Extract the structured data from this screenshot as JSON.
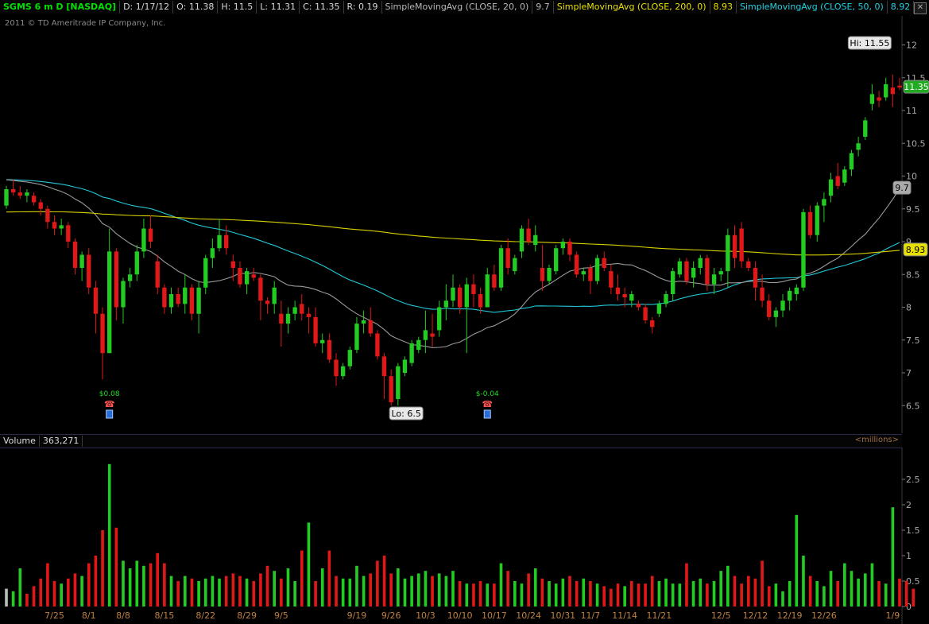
{
  "header": {
    "symbol": "SGMS 6 m D [NASDAQ]",
    "date": "D: 1/17/12",
    "open": "O: 11.38",
    "high": "H: 11.5",
    "low": "L: 11.31",
    "close": "C: 11.35",
    "range": "R: 0.19",
    "sma20_label": "SimpleMovingAvg (CLOSE, 20, 0)",
    "sma20_value": "9.7",
    "sma200_label": "SimpleMovingAvg (CLOSE, 200, 0)",
    "sma200_value": "8.93",
    "sma50_label": "SimpleMovingAvg (CLOSE, 50, 0)",
    "sma50_value": "8.92",
    "close_icon": "window-close-icon"
  },
  "copyright": "2011 © TD Ameritrade IP Company, Inc.",
  "volume_header": {
    "label": "Volume",
    "value": "363,271",
    "unit": "<millions>"
  },
  "colors": {
    "up": "#22cc22",
    "down": "#e01818",
    "sma20": "#9a9a9a",
    "sma50": "#22c8d8",
    "sma200": "#d8d000",
    "background": "#000000"
  },
  "chart_data": [
    {
      "type": "candlestick",
      "title": "SGMS 6 m D [NASDAQ]",
      "ylim": [
        6.2,
        12.2
      ],
      "yticks": [
        6.5,
        7,
        7.5,
        8,
        8.5,
        9,
        9.5,
        10,
        10.5,
        11,
        11.5,
        12
      ],
      "xlabels": [
        "7/25",
        "8/1",
        "8/8",
        "8/15",
        "8/22",
        "8/29",
        "9/5",
        "9/19",
        "9/26",
        "10/3",
        "10/10",
        "10/17",
        "10/24",
        "10/31",
        "11/7",
        "11/14",
        "11/21",
        "12/5",
        "12/12",
        "12/19",
        "12/26",
        "1/9"
      ],
      "annotations": {
        "high": "Hi: 11.55",
        "low": "Lo: 6.5",
        "last_price": "11.35",
        "sma20_tag": "9.7",
        "sma200_tag": "8.93",
        "dividend1": "$0.08",
        "dividend2": "$-0.04"
      },
      "candles": [
        [
          9.55,
          9.85,
          9.5,
          9.8
        ],
        [
          9.8,
          9.95,
          9.7,
          9.75
        ],
        [
          9.75,
          9.85,
          9.65,
          9.7
        ],
        [
          9.7,
          9.8,
          9.6,
          9.75
        ],
        [
          9.7,
          9.75,
          9.55,
          9.6
        ],
        [
          9.6,
          9.65,
          9.4,
          9.5
        ],
        [
          9.5,
          9.55,
          9.2,
          9.3
        ],
        [
          9.3,
          9.4,
          9.1,
          9.2
        ],
        [
          9.2,
          9.35,
          9.1,
          9.25
        ],
        [
          9.25,
          9.3,
          8.9,
          9.0
        ],
        [
          9.0,
          9.05,
          8.5,
          8.6
        ],
        [
          8.6,
          8.85,
          8.4,
          8.8
        ],
        [
          8.8,
          8.9,
          8.2,
          8.3
        ],
        [
          8.3,
          8.4,
          7.6,
          7.9
        ],
        [
          7.9,
          8.0,
          6.9,
          7.3
        ],
        [
          7.3,
          9.2,
          7.3,
          8.85
        ],
        [
          8.85,
          8.9,
          7.8,
          8.0
        ],
        [
          8.0,
          8.45,
          7.75,
          8.4
        ],
        [
          8.4,
          8.6,
          8.3,
          8.5
        ],
        [
          8.5,
          8.95,
          8.4,
          8.85
        ],
        [
          8.85,
          9.35,
          8.75,
          9.2
        ],
        [
          9.2,
          9.4,
          8.9,
          9.0
        ],
        [
          8.7,
          8.8,
          8.2,
          8.3
        ],
        [
          8.3,
          8.35,
          7.9,
          8.0
        ],
        [
          8.0,
          8.3,
          7.9,
          8.2
        ],
        [
          8.2,
          8.3,
          8.0,
          8.05
        ],
        [
          8.05,
          8.5,
          7.9,
          8.3
        ],
        [
          8.3,
          8.35,
          7.8,
          7.9
        ],
        [
          7.9,
          8.4,
          7.6,
          8.3
        ],
        [
          8.3,
          8.8,
          8.2,
          8.75
        ],
        [
          8.75,
          9.05,
          8.6,
          8.9
        ],
        [
          8.9,
          9.35,
          8.85,
          9.1
        ],
        [
          9.1,
          9.25,
          8.8,
          8.9
        ],
        [
          8.7,
          8.8,
          8.4,
          8.6
        ],
        [
          8.6,
          8.7,
          8.3,
          8.35
        ],
        [
          8.35,
          8.6,
          8.2,
          8.55
        ],
        [
          8.5,
          8.6,
          8.4,
          8.45
        ],
        [
          8.45,
          8.5,
          7.8,
          8.1
        ],
        [
          8.1,
          8.15,
          7.9,
          8.05
        ],
        [
          8.05,
          8.4,
          7.9,
          8.3
        ],
        [
          7.9,
          8.1,
          7.4,
          7.75
        ],
        [
          7.75,
          8.0,
          7.6,
          7.9
        ],
        [
          7.9,
          8.1,
          7.8,
          8.0
        ],
        [
          8.05,
          8.2,
          7.8,
          7.9
        ],
        [
          7.9,
          8.0,
          7.6,
          7.85
        ],
        [
          7.85,
          8.0,
          7.4,
          7.45
        ],
        [
          7.45,
          7.6,
          7.3,
          7.5
        ],
        [
          7.5,
          7.6,
          7.15,
          7.2
        ],
        [
          7.2,
          7.3,
          6.8,
          6.95
        ],
        [
          6.95,
          7.15,
          6.9,
          7.1
        ],
        [
          7.1,
          7.4,
          7.05,
          7.35
        ],
        [
          7.35,
          7.85,
          7.3,
          7.75
        ],
        [
          7.75,
          7.95,
          7.6,
          7.8
        ],
        [
          7.8,
          8.0,
          7.55,
          7.6
        ],
        [
          7.6,
          7.65,
          7.2,
          7.25
        ],
        [
          7.25,
          7.3,
          6.6,
          6.95
        ],
        [
          6.95,
          7.05,
          6.5,
          6.55
        ],
        [
          6.6,
          7.15,
          6.5,
          7.1
        ],
        [
          7.0,
          7.25,
          6.95,
          7.2
        ],
        [
          7.15,
          7.5,
          7.1,
          7.45
        ],
        [
          7.35,
          7.55,
          7.3,
          7.5
        ],
        [
          7.5,
          7.95,
          7.3,
          7.65
        ],
        [
          7.6,
          7.9,
          7.4,
          7.55
        ],
        [
          7.65,
          8.1,
          7.55,
          8.0
        ],
        [
          8.0,
          8.35,
          7.8,
          8.1
        ],
        [
          8.1,
          8.5,
          8.0,
          8.3
        ],
        [
          8.3,
          8.35,
          7.9,
          8.0
        ],
        [
          8.0,
          8.45,
          7.3,
          8.35
        ],
        [
          8.35,
          8.5,
          8.0,
          8.2
        ],
        [
          8.2,
          8.3,
          7.9,
          8.0
        ],
        [
          8.0,
          8.6,
          8.0,
          8.5
        ],
        [
          8.5,
          8.65,
          8.25,
          8.3
        ],
        [
          8.3,
          8.95,
          8.25,
          8.9
        ],
        [
          8.9,
          9.05,
          8.5,
          8.6
        ],
        [
          8.55,
          8.8,
          8.5,
          8.75
        ],
        [
          8.85,
          9.25,
          8.75,
          9.2
        ],
        [
          9.2,
          9.35,
          8.95,
          9.0
        ],
        [
          8.95,
          9.25,
          8.85,
          9.1
        ],
        [
          8.6,
          8.95,
          8.25,
          8.4
        ],
        [
          8.4,
          8.65,
          8.35,
          8.6
        ],
        [
          8.55,
          8.95,
          8.5,
          8.9
        ],
        [
          8.9,
          9.05,
          8.8,
          9.0
        ],
        [
          9.0,
          9.05,
          8.7,
          8.8
        ],
        [
          8.8,
          8.85,
          8.45,
          8.5
        ],
        [
          8.5,
          8.6,
          8.4,
          8.55
        ],
        [
          8.6,
          8.65,
          8.2,
          8.4
        ],
        [
          8.4,
          8.8,
          8.35,
          8.75
        ],
        [
          8.75,
          8.85,
          8.55,
          8.6
        ],
        [
          8.55,
          8.65,
          8.2,
          8.3
        ],
        [
          8.3,
          8.5,
          8.1,
          8.2
        ],
        [
          8.2,
          8.3,
          8.0,
          8.15
        ],
        [
          8.1,
          8.25,
          8.0,
          8.2
        ],
        [
          8.05,
          8.1,
          7.95,
          8.0
        ],
        [
          8.0,
          8.05,
          7.75,
          7.8
        ],
        [
          7.8,
          7.85,
          7.6,
          7.7
        ],
        [
          7.9,
          8.1,
          7.85,
          8.05
        ],
        [
          8.05,
          8.25,
          8.0,
          8.2
        ],
        [
          8.2,
          8.6,
          8.1,
          8.55
        ],
        [
          8.5,
          8.75,
          8.45,
          8.7
        ],
        [
          8.7,
          8.75,
          8.35,
          8.4
        ],
        [
          8.45,
          8.7,
          8.3,
          8.6
        ],
        [
          8.6,
          8.8,
          8.5,
          8.75
        ],
        [
          8.75,
          8.8,
          8.25,
          8.35
        ],
        [
          8.35,
          8.6,
          8.2,
          8.5
        ],
        [
          8.5,
          8.6,
          8.4,
          8.55
        ],
        [
          8.55,
          9.2,
          8.3,
          9.1
        ],
        [
          9.1,
          9.25,
          8.6,
          8.75
        ],
        [
          9.2,
          9.3,
          8.6,
          8.7
        ],
        [
          8.7,
          8.75,
          8.55,
          8.6
        ],
        [
          8.6,
          8.7,
          8.1,
          8.3
        ],
        [
          8.3,
          8.5,
          8.0,
          8.1
        ],
        [
          8.1,
          8.2,
          7.8,
          7.85
        ],
        [
          7.85,
          8.0,
          7.7,
          7.95
        ],
        [
          7.95,
          8.2,
          7.85,
          8.1
        ],
        [
          8.1,
          8.3,
          7.95,
          8.25
        ],
        [
          8.2,
          8.35,
          8.1,
          8.3
        ],
        [
          8.3,
          9.5,
          8.25,
          9.45
        ],
        [
          9.45,
          9.55,
          9.05,
          9.1
        ],
        [
          9.1,
          9.6,
          9.0,
          9.55
        ],
        [
          9.55,
          9.75,
          9.3,
          9.65
        ],
        [
          9.7,
          10.05,
          9.6,
          9.95
        ],
        [
          10.0,
          10.2,
          9.8,
          9.85
        ],
        [
          9.9,
          10.15,
          9.85,
          10.1
        ],
        [
          10.1,
          10.4,
          10.0,
          10.35
        ],
        [
          10.4,
          10.6,
          10.3,
          10.5
        ],
        [
          10.6,
          10.9,
          10.55,
          10.85
        ],
        [
          11.1,
          11.4,
          11.0,
          11.25
        ],
        [
          11.2,
          11.3,
          11.05,
          11.15
        ],
        [
          11.2,
          11.5,
          11.15,
          11.4
        ],
        [
          11.35,
          11.55,
          11.05,
          11.25
        ],
        [
          11.38,
          11.5,
          11.31,
          11.35
        ]
      ]
    },
    {
      "type": "bar",
      "title": "Volume",
      "unit": "millions",
      "ylim": [
        0,
        3.0
      ],
      "yticks": [
        0,
        0.5,
        1,
        1.5,
        2,
        2.5
      ],
      "values": [
        0.35,
        0.3,
        0.75,
        0.25,
        0.4,
        0.55,
        0.85,
        0.5,
        0.45,
        0.55,
        0.65,
        0.6,
        0.85,
        1.0,
        1.5,
        2.8,
        1.55,
        0.9,
        0.75,
        0.9,
        0.8,
        0.85,
        1.05,
        0.85,
        0.6,
        0.5,
        0.6,
        0.55,
        0.5,
        0.55,
        0.6,
        0.55,
        0.6,
        0.65,
        0.6,
        0.55,
        0.5,
        0.65,
        0.8,
        0.7,
        0.55,
        0.75,
        0.5,
        1.1,
        1.65,
        0.5,
        0.75,
        1.1,
        0.6,
        0.55,
        0.55,
        0.8,
        0.6,
        0.65,
        0.9,
        1.0,
        0.65,
        0.75,
        0.55,
        0.6,
        0.65,
        0.7,
        0.6,
        0.65,
        0.6,
        0.7,
        0.5,
        0.45,
        0.45,
        0.5,
        0.45,
        0.45,
        0.85,
        0.7,
        0.5,
        0.45,
        0.65,
        0.75,
        0.55,
        0.5,
        0.45,
        0.55,
        0.6,
        0.5,
        0.55,
        0.5,
        0.45,
        0.4,
        0.35,
        0.45,
        0.4,
        0.5,
        0.45,
        0.45,
        0.6,
        0.5,
        0.55,
        0.45,
        0.45,
        0.85,
        0.5,
        0.55,
        0.45,
        0.5,
        0.7,
        0.8,
        0.6,
        0.45,
        0.6,
        0.55,
        0.9,
        0.4,
        0.45,
        0.3,
        0.5,
        1.8,
        1.0,
        0.6,
        0.5,
        0.4,
        0.7,
        0.5,
        0.85,
        0.7,
        0.55,
        0.65,
        0.85,
        0.5,
        0.45,
        1.95,
        0.55,
        0.5,
        0.35
      ],
      "up_days": [
        true,
        true,
        true,
        false,
        false,
        false,
        false,
        false,
        true,
        false,
        false,
        true,
        false,
        false,
        false,
        true,
        false,
        true,
        true,
        true,
        true,
        false,
        false,
        false,
        true,
        false,
        true,
        false,
        true,
        true,
        true,
        true,
        false,
        false,
        false,
        true,
        false,
        false,
        false,
        true,
        false,
        true,
        true,
        false,
        true,
        false,
        true,
        false,
        false,
        true,
        true,
        true,
        true,
        false,
        false,
        false,
        false,
        true,
        true,
        true,
        true,
        true,
        false,
        true,
        true,
        true,
        false,
        true,
        false,
        false,
        true,
        false,
        true,
        false,
        true,
        true,
        false,
        true,
        false,
        true,
        true,
        true,
        false,
        false,
        true,
        false,
        true,
        false,
        false,
        false,
        true,
        false,
        false,
        false,
        false,
        true,
        true,
        true,
        true,
        false,
        true,
        true,
        false,
        true,
        true,
        true,
        false,
        false,
        false,
        false,
        false,
        false,
        true,
        true,
        true,
        true,
        true,
        false,
        true,
        true,
        true,
        false,
        true,
        true,
        true,
        true,
        true,
        false,
        true,
        true,
        false
      ]
    }
  ]
}
